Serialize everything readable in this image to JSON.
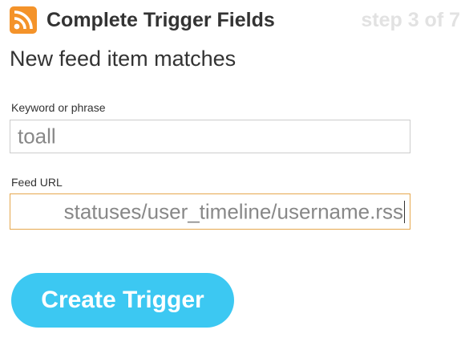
{
  "header": {
    "icon": "rss-feed-icon",
    "title": "Complete Trigger Fields",
    "step": "step 3 of 7"
  },
  "subtitle": "New feed item matches",
  "fields": [
    {
      "label": "Keyword or phrase",
      "value": "toall"
    },
    {
      "label": "Feed URL",
      "value": "statuses/user_timeline/username.rss"
    }
  ],
  "create_button": {
    "label": "Create Trigger"
  },
  "colors": {
    "rss_orange": "#f4932a",
    "button_blue": "#3cc8f2",
    "focus_border": "#e6a84e",
    "step_gray": "#e2e2e2"
  }
}
